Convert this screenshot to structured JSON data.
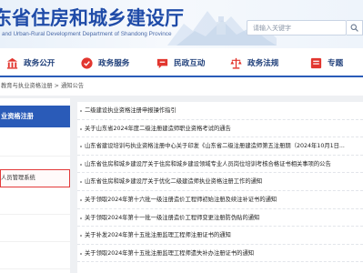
{
  "header": {
    "title": "东省住房和城乡建设厅",
    "subtitle": "and Urban-Rural Development Department of Shandong Province",
    "search_placeholder": "请输入关键字"
  },
  "nav": {
    "items": [
      {
        "label": "政务公开",
        "icon": "building-icon"
      },
      {
        "label": "政务服务",
        "icon": "service-icon"
      },
      {
        "label": "民政互动",
        "icon": "chat-icon"
      },
      {
        "label": "政务法规",
        "icon": "scale-icon"
      },
      {
        "label": "专题",
        "icon": "topic-icon"
      }
    ]
  },
  "breadcrumb": {
    "items": [
      "教育与执业资格注册",
      "通知公告"
    ],
    "separator": " > "
  },
  "sidebar": {
    "heading": "业资格注册",
    "items": [
      {
        "label": "人员管理系统",
        "highlighted": true
      },
      {
        "label": "",
        "highlighted": false
      },
      {
        "label": "",
        "highlighted": false
      },
      {
        "label": "",
        "highlighted": false
      },
      {
        "label": "",
        "highlighted": false
      }
    ]
  },
  "news": {
    "items": [
      "二级建设执业资格注册申报操作指引",
      "关于山东省2024年度二级注册建造师职业资格考试的通告",
      "山东省建设培训与执业资格注册中心关于印发《山东省二级注册建造师第五注册期（2024年10月1日...",
      "山东省住房和城乡建设厅关于住房和城乡建设领域专业人员岗位培训考核合格证书相关事项的公告",
      "山东省住房和城乡建设厅关于优化二级建造师执业资格注册工作的通知",
      "关于领取2024年第十六批一级注册造价工程师初始注册及续注补证书的通知",
      "关于领取2024年第十一批一级注册造价工程师变更注册防伪贴的通知",
      "关于补发2024年第十五批注册监理工程师注册证书的通知",
      "关于领取2024年第十五批注册监理工程师遗失补办注册证书的通知"
    ]
  },
  "colors": {
    "brand_blue": "#2a5bb8",
    "title_blue": "#1f4ba8",
    "highlight_red": "#e33a3a"
  }
}
